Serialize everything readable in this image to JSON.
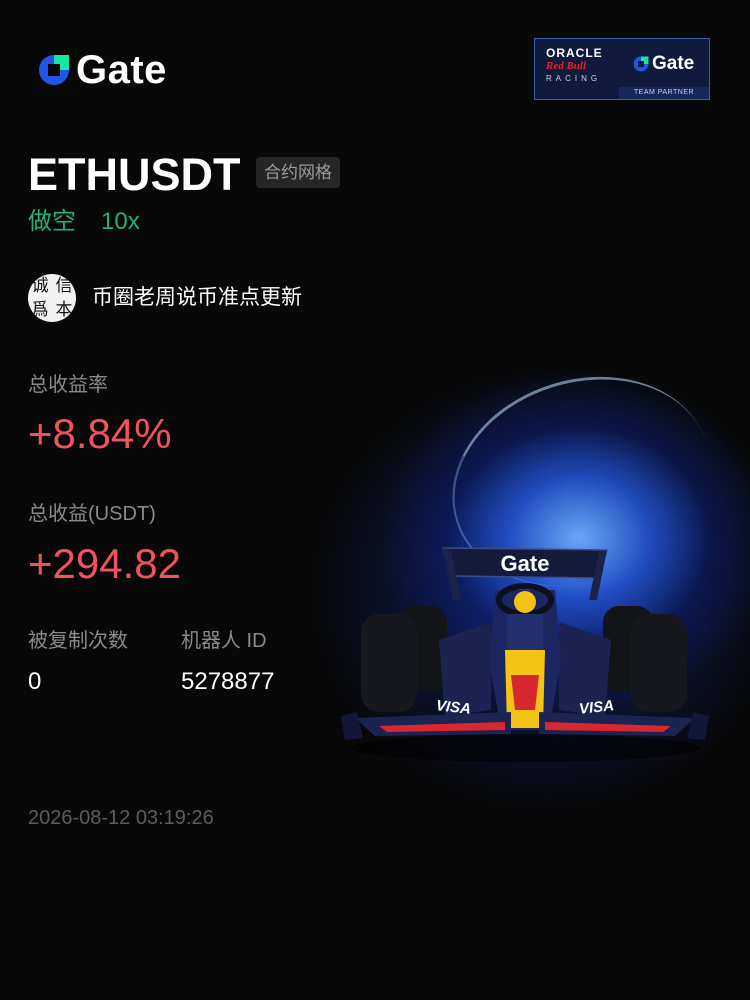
{
  "brand": {
    "name": "Gate",
    "colors": {
      "blue": "#2354e6",
      "teal": "#17e6a1"
    }
  },
  "partner_badge": {
    "line1": "ORACLE",
    "line2": "Red Bull",
    "line3": "RACING",
    "gate_label": "Gate",
    "footer": "TEAM PARTNER"
  },
  "trade": {
    "symbol": "ETHUSDT",
    "strategy_badge": "合约网格",
    "direction": "做空",
    "leverage": "10x"
  },
  "author": {
    "avatar_chars": [
      "诚",
      "信",
      "爲",
      "本"
    ],
    "name": "币圈老周说币准点更新"
  },
  "stats": {
    "total_return_rate_label": "总收益率",
    "total_return_rate_value": "+8.84%",
    "total_pnl_label": "总收益(USDT)",
    "total_pnl_value": "+294.82",
    "copies_label": "被复制次数",
    "copies_value": "0",
    "bot_id_label": "机器人 ID",
    "bot_id_value": "5278877"
  },
  "timestamp": "2026-08-12 03:19:26",
  "car_wing_text": "Gate",
  "car_sponsor_text": "VISA",
  "colors": {
    "background": "#080808",
    "positive": "#f0525f",
    "short_green": "#27b071",
    "label_gray": "#8a8a8a"
  }
}
